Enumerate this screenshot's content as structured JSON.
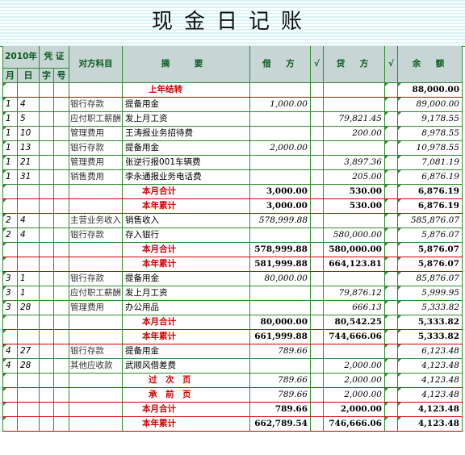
{
  "title": "现金日记账",
  "headers": {
    "year": "2010年",
    "voucher": "凭 证",
    "account": "对方科目",
    "summary": "摘　要",
    "debit": "借　方",
    "credit": "贷　方",
    "balance": "余　额",
    "check": "√",
    "month": "月",
    "day": "日",
    "zi": "字",
    "hao": "号"
  },
  "rows": [
    {
      "m": "",
      "d": "",
      "acct": "",
      "desc": "上年结转",
      "debit": "",
      "credit": "",
      "balance": "88,000.00",
      "style": "carry"
    },
    {
      "m": "1",
      "d": "4",
      "acct": "银行存款",
      "desc": "提备用金",
      "debit": "1,000.00",
      "credit": "",
      "balance": "89,000.00",
      "style": "entry"
    },
    {
      "m": "1",
      "d": "5",
      "acct": "应付职工薪酬",
      "desc": "发上月工资",
      "debit": "",
      "credit": "79,821.45",
      "balance": "9,178.55",
      "style": "entry"
    },
    {
      "m": "1",
      "d": "10",
      "acct": "管理费用",
      "desc": "王涛报业务招待费",
      "debit": "",
      "credit": "200.00",
      "balance": "8,978.55",
      "style": "entry"
    },
    {
      "m": "1",
      "d": "13",
      "acct": "银行存款",
      "desc": "提备用金",
      "debit": "2,000.00",
      "credit": "",
      "balance": "10,978.55",
      "style": "entry"
    },
    {
      "m": "1",
      "d": "21",
      "acct": "管理费用",
      "desc": "张逆行报001车辆费",
      "debit": "",
      "credit": "3,897.36",
      "balance": "7,081.19",
      "style": "entry"
    },
    {
      "m": "1",
      "d": "31",
      "acct": "销售费用",
      "desc": "李永通报业务电话费",
      "debit": "",
      "credit": "205.00",
      "balance": "6,876.19",
      "style": "entry"
    },
    {
      "m": "",
      "d": "",
      "acct": "",
      "desc": "本月合计",
      "debit": "3,000.00",
      "credit": "530.00",
      "balance": "6,876.19",
      "style": "total"
    },
    {
      "m": "",
      "d": "",
      "acct": "",
      "desc": "本年累计",
      "debit": "3,000.00",
      "credit": "530.00",
      "balance": "6,876.19",
      "style": "total"
    },
    {
      "m": "2",
      "d": "4",
      "acct": "主营业务收入",
      "desc": "销售收入",
      "debit": "578,999.88",
      "credit": "",
      "balance": "585,876.07",
      "style": "entry"
    },
    {
      "m": "2",
      "d": "4",
      "acct": "银行存款",
      "desc": "存入银行",
      "debit": "",
      "credit": "580,000.00",
      "balance": "5,876.07",
      "style": "entry"
    },
    {
      "m": "",
      "d": "",
      "acct": "",
      "desc": "本月合计",
      "debit": "578,999.88",
      "credit": "580,000.00",
      "balance": "5,876.07",
      "style": "total"
    },
    {
      "m": "",
      "d": "",
      "acct": "",
      "desc": "本年累计",
      "debit": "581,999.88",
      "credit": "664,123.81",
      "balance": "5,876.07",
      "style": "total"
    },
    {
      "m": "3",
      "d": "1",
      "acct": "银行存款",
      "desc": "提备用金",
      "debit": "80,000.00",
      "credit": "",
      "balance": "85,876.07",
      "style": "entry"
    },
    {
      "m": "3",
      "d": "1",
      "acct": "应付职工薪酬",
      "desc": "发上月工资",
      "debit": "",
      "credit": "79,876.12",
      "balance": "5,999.95",
      "style": "entry"
    },
    {
      "m": "3",
      "d": "28",
      "acct": "管理费用",
      "desc": "办公用品",
      "debit": "",
      "credit": "666.13",
      "balance": "5,333.82",
      "style": "entry"
    },
    {
      "m": "",
      "d": "",
      "acct": "",
      "desc": "本月合计",
      "debit": "80,000.00",
      "credit": "80,542.25",
      "balance": "5,333.82",
      "style": "total"
    },
    {
      "m": "",
      "d": "",
      "acct": "",
      "desc": "本年累计",
      "debit": "661,999.88",
      "credit": "744,666.06",
      "balance": "5,333.82",
      "style": "total"
    },
    {
      "m": "4",
      "d": "27",
      "acct": "银行存款",
      "desc": "提备用金",
      "debit": "789.66",
      "credit": "",
      "balance": "6,123.48",
      "style": "entry"
    },
    {
      "m": "4",
      "d": "28",
      "acct": "其他应收款",
      "desc": "武顺风借差费",
      "debit": "",
      "credit": "2,000.00",
      "balance": "4,123.48",
      "style": "entry"
    },
    {
      "m": "",
      "d": "",
      "acct": "",
      "desc": "过　次　页",
      "debit": "789.66",
      "credit": "2,000.00",
      "balance": "4,123.48",
      "style": "page"
    },
    {
      "m": "",
      "d": "",
      "acct": "",
      "desc": "承　前　页",
      "debit": "789.66",
      "credit": "2,000.00",
      "balance": "4,123.48",
      "style": "page"
    },
    {
      "m": "",
      "d": "",
      "acct": "",
      "desc": "本月合计",
      "debit": "789.66",
      "credit": "2,000.00",
      "balance": "4,123.48",
      "style": "total"
    },
    {
      "m": "",
      "d": "",
      "acct": "",
      "desc": "本年累计",
      "debit": "662,789.54",
      "credit": "746,666.06",
      "balance": "4,123.48",
      "style": "total"
    }
  ]
}
